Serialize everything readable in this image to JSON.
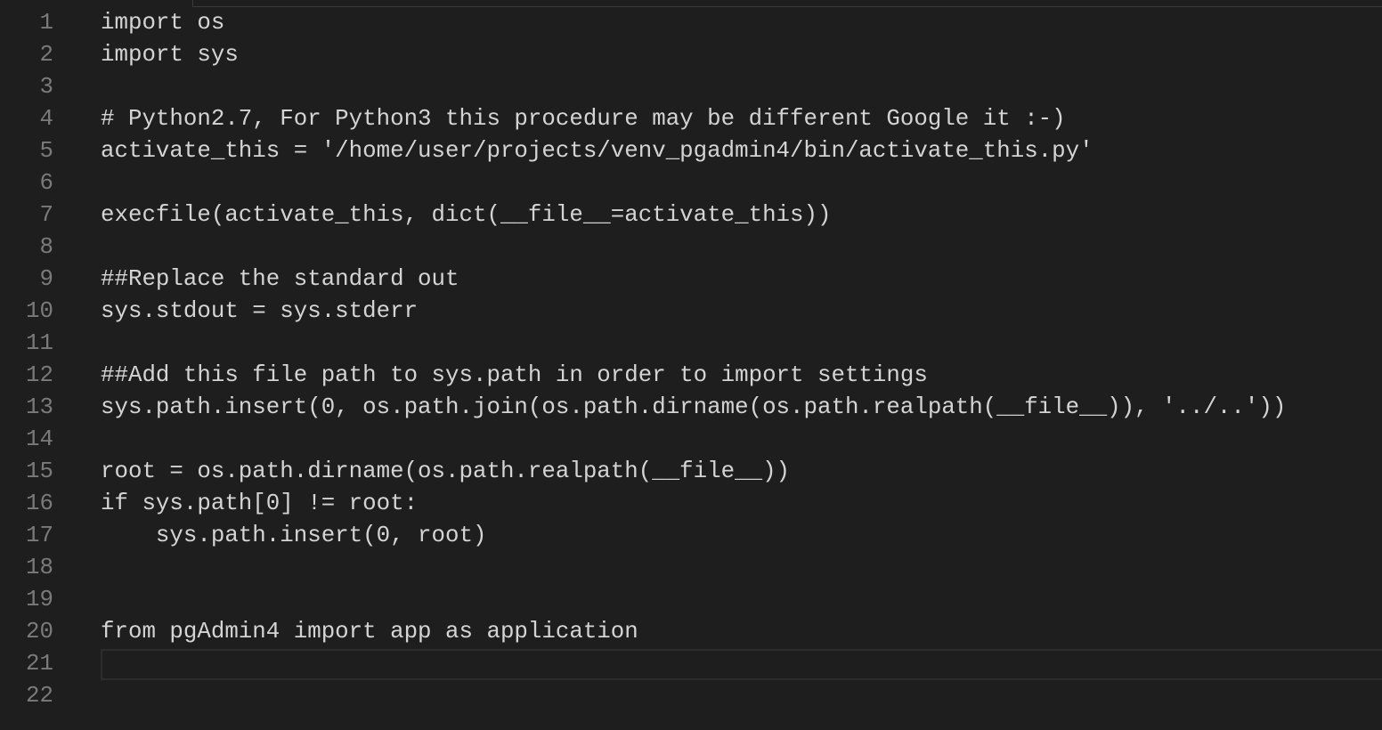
{
  "editor": {
    "lines": [
      {
        "num": "1",
        "text": "import os"
      },
      {
        "num": "2",
        "text": "import sys"
      },
      {
        "num": "3",
        "text": ""
      },
      {
        "num": "4",
        "text": "# Python2.7, For Python3 this procedure may be different Google it :-)"
      },
      {
        "num": "5",
        "text": "activate_this = '/home/user/projects/venv_pgadmin4/bin/activate_this.py'"
      },
      {
        "num": "6",
        "text": ""
      },
      {
        "num": "7",
        "text": "execfile(activate_this, dict(__file__=activate_this))"
      },
      {
        "num": "8",
        "text": ""
      },
      {
        "num": "9",
        "text": "##Replace the standard out"
      },
      {
        "num": "10",
        "text": "sys.stdout = sys.stderr"
      },
      {
        "num": "11",
        "text": ""
      },
      {
        "num": "12",
        "text": "##Add this file path to sys.path in order to import settings"
      },
      {
        "num": "13",
        "text": "sys.path.insert(0, os.path.join(os.path.dirname(os.path.realpath(__file__)), '../..'))"
      },
      {
        "num": "14",
        "text": ""
      },
      {
        "num": "15",
        "text": "root = os.path.dirname(os.path.realpath(__file__))"
      },
      {
        "num": "16",
        "text": "if sys.path[0] != root:"
      },
      {
        "num": "17",
        "text": "    sys.path.insert(0, root)"
      },
      {
        "num": "18",
        "text": ""
      },
      {
        "num": "19",
        "text": ""
      },
      {
        "num": "20",
        "text": "from pgAdmin4 import app as application"
      },
      {
        "num": "21",
        "text": ""
      },
      {
        "num": "22",
        "text": ""
      }
    ],
    "current_line": "21",
    "colors": {
      "background": "#1e1e1e",
      "text": "#d4d4d4",
      "line_number": "#7a7a7a"
    }
  }
}
